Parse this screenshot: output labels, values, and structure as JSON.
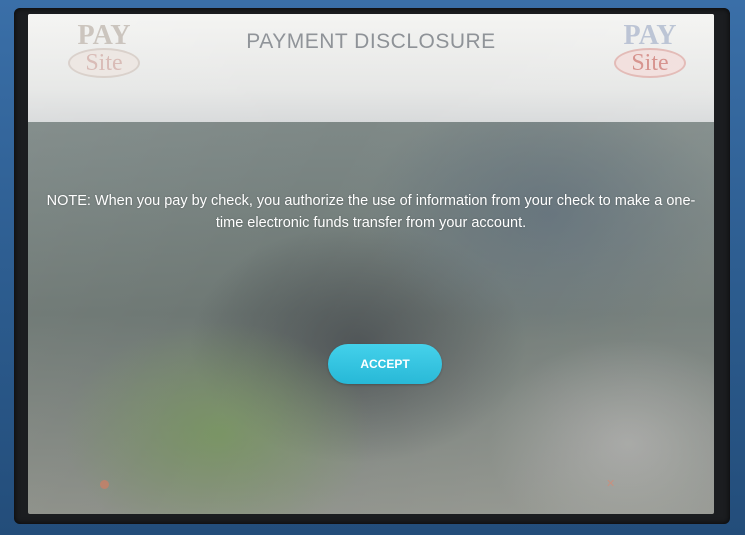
{
  "header": {
    "title": "PAYMENT DISCLOSURE",
    "logo_left": {
      "top": "PAY",
      "bottom": "Site"
    },
    "logo_right": {
      "top": "PAY",
      "bottom": "Site"
    }
  },
  "main": {
    "note": "NOTE: When you pay by check, you authorize the use of information from your check to make a one-time electronic funds transfer from your account.",
    "accept_label": "ACCEPT"
  },
  "footer": {
    "left_label": "",
    "right_label": ""
  },
  "colors": {
    "accept_button": "#21b6d6",
    "header_bg": "#e6e7e6",
    "kiosk_frame": "#2f5f93"
  }
}
